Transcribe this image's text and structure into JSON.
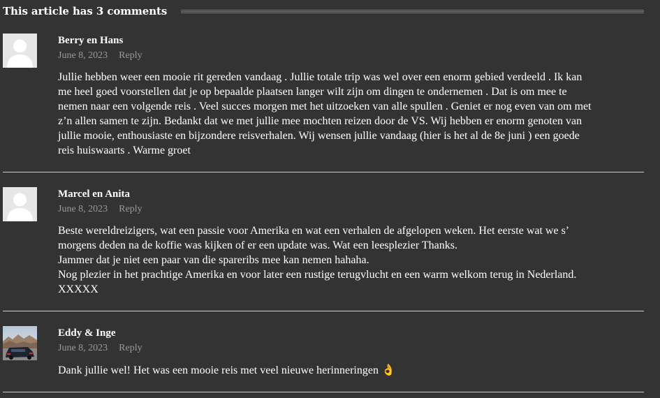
{
  "header": {
    "title": "This article has 3 comments"
  },
  "comments": [
    {
      "author": "Berry en Hans",
      "date": "June 8, 2023",
      "reply_label": "Reply",
      "avatar": "default-avatar",
      "lines": [
        "Jullie hebben weer een mooie rit gereden vandaag . Jullie totale trip was wel over een enorm gebied verdeeld . Ik kan",
        "me heel goed voorstellen dat je op bepaalde plaatsen langer wilt zijn om dingen te ondernemen . Dat is om mee te",
        "nemen naar een volgende reis . Veel succes morgen met het uitzoeken van alle spullen . Geniet er nog even van om met",
        "z’n allen samen te zijn. Bedankt dat we met jullie mee mochten reizen door de VS. Wij hebben er enorm genoten van",
        "jullie mooie, enthousiaste en bijzondere reisverhalen. Wij wensen jullie vandaag (hier is het al de 8e juni ) een goede",
        "reis huiswaarts . Warme groet"
      ]
    },
    {
      "author": "Marcel en Anita",
      "date": "June 8, 2023",
      "reply_label": "Reply",
      "avatar": "default-avatar",
      "lines": [
        "Beste wereldreizigers, wat een passie voor Amerika en wat een verhalen de afgelopen weken. Het eerste wat we s’",
        "morgens deden na de koffie was kijken of er een update was. Wat een leesplezier Thanks.",
        "Jammer dat je niet een paar van die spareribs mee kan nemen hahaha.",
        "Nog plezier in het prachtige Amerika en voor later een rustige terugvlucht en een warm welkom terug in Nederland.",
        "XXXXX"
      ]
    },
    {
      "author": "Eddy & Inge",
      "date": "June 8, 2023",
      "reply_label": "Reply",
      "avatar": "photo-avatar-car",
      "lines": [
        "Dank jullie wel! Het was een mooie reis met veel nieuwe herinneringen 👌"
      ]
    }
  ]
}
